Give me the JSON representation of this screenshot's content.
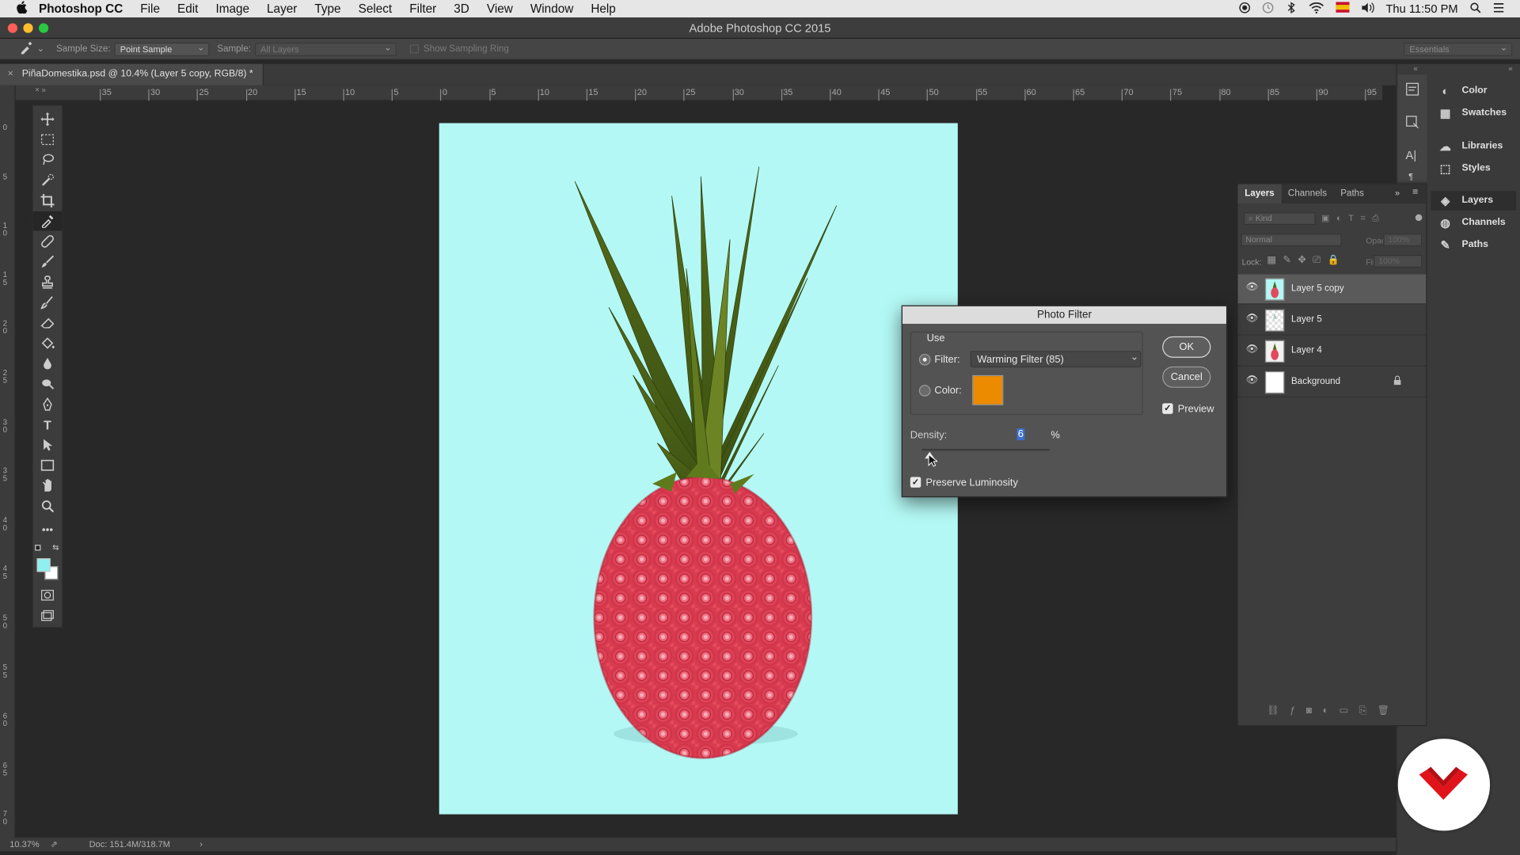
{
  "menubar": {
    "app_name": "Photoshop CC",
    "items": [
      "File",
      "Edit",
      "Image",
      "Layer",
      "Type",
      "Select",
      "Filter",
      "3D",
      "View",
      "Window",
      "Help"
    ],
    "clock": "Thu 11:50 PM"
  },
  "window": {
    "title": "Adobe Photoshop CC 2015"
  },
  "options_bar": {
    "sample_size_label": "Sample Size:",
    "sample_size_value": "Point Sample",
    "sample_label": "Sample:",
    "sample_value": "All Layers",
    "sampling_ring_label": "Show Sampling Ring",
    "workspace": "Essentials"
  },
  "document": {
    "tab_title": "PiñaDomestika.psd @ 10.4% (Layer 5 copy, RGB/8) *"
  },
  "rulers": {
    "horizontal_ticks": [
      "35",
      "30",
      "25",
      "20",
      "15",
      "10",
      "5",
      "0",
      "5",
      "10",
      "15",
      "20",
      "25",
      "30",
      "35",
      "40",
      "45",
      "50",
      "55",
      "60",
      "65",
      "70",
      "75",
      "80",
      "85",
      "90",
      "95"
    ],
    "vertical_ticks": [
      "0",
      "5",
      "1\n0",
      "1\n5",
      "2\n0",
      "2\n5",
      "3\n0",
      "3\n5",
      "4\n0",
      "4\n5",
      "5\n0",
      "5\n5",
      "6\n0",
      "6\n5",
      "7\n0"
    ]
  },
  "status_bar": {
    "zoom": "10.37%",
    "doc_size": "Doc: 151.4M/318.7M"
  },
  "dock": {
    "items": [
      {
        "label": "Color",
        "icon": "color-wheel-icon"
      },
      {
        "label": "Swatches",
        "icon": "grid-icon"
      },
      {
        "label": "Libraries",
        "icon": "cloud-icon"
      },
      {
        "label": "Styles",
        "icon": "styles-icon"
      },
      {
        "label": "Layers",
        "icon": "layers-icon"
      },
      {
        "label": "Channels",
        "icon": "channels-icon"
      },
      {
        "label": "Paths",
        "icon": "pen-path-icon"
      }
    ]
  },
  "layers_panel": {
    "tabs": [
      "Layers",
      "Channels",
      "Paths"
    ],
    "kind_placeholder": "Kind",
    "blend_mode": "Normal",
    "opacity_label": "Opacity:",
    "opacity_value": "100%",
    "lock_label": "Lock:",
    "fill_label": "Fill:",
    "fill_value": "100%",
    "layers": [
      {
        "name": "Layer 5 copy",
        "selected": true,
        "thumb": "pineapple"
      },
      {
        "name": "Layer 5",
        "selected": false,
        "thumb": "transparent"
      },
      {
        "name": "Layer 4",
        "selected": false,
        "thumb": "pineapple"
      },
      {
        "name": "Background",
        "selected": false,
        "thumb": "white",
        "locked": true
      }
    ]
  },
  "photo_filter": {
    "title": "Photo Filter",
    "use_label": "Use",
    "filter_label": "Filter:",
    "filter_value": "Warming Filter (85)",
    "color_label": "Color:",
    "color_swatch": "#ec8a00",
    "density_label": "Density:",
    "density_value": "6",
    "density_unit": "%",
    "density_fraction": 0.06,
    "preserve_luminosity_label": "Preserve Luminosity",
    "preserve_luminosity": true,
    "preview_label": "Preview",
    "preview": true,
    "ok_label": "OK",
    "cancel_label": "Cancel"
  },
  "colors": {
    "canvas_bg": "#b3f8f4",
    "foreground_swatch": "#8ef0f0",
    "background_swatch": "#ffffff",
    "badge_red": "#e0131b"
  }
}
